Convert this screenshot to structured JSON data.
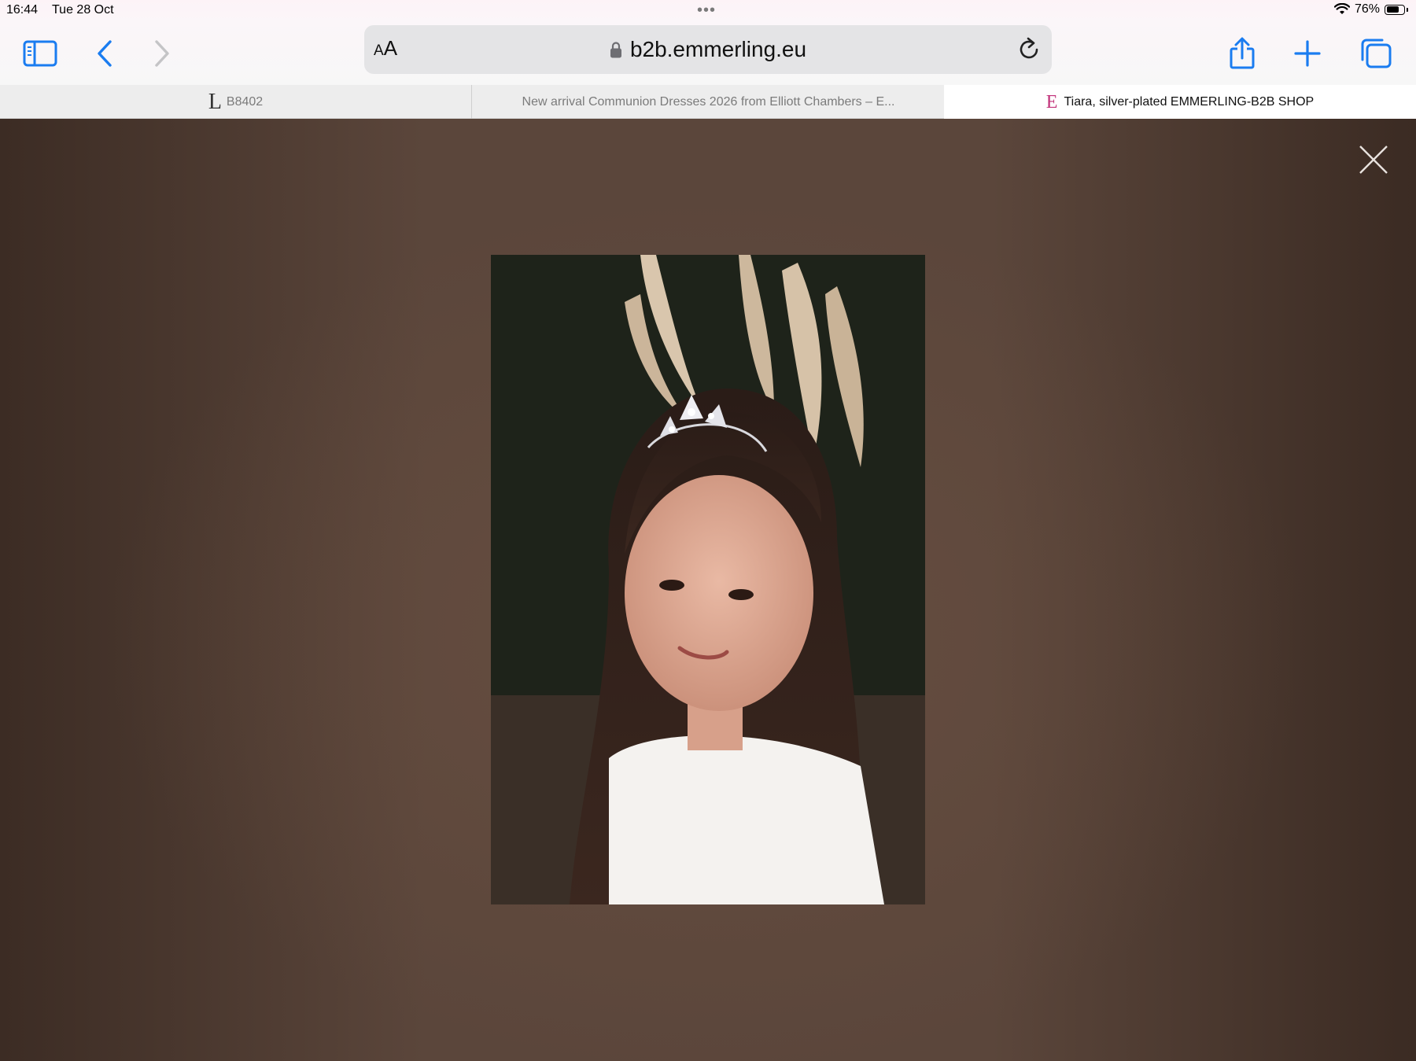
{
  "status_bar": {
    "time": "16:44",
    "date": "Tue 28 Oct",
    "battery": "76%",
    "battery_level": 0.76
  },
  "toolbar": {
    "text_size_label_small": "A",
    "text_size_label_large": "A",
    "url": "b2b.emmerling.eu"
  },
  "tabs": [
    {
      "favicon": "L",
      "title": "B8402"
    },
    {
      "title": "New arrival Communion Dresses 2026 from Elliott Chambers – E..."
    },
    {
      "favicon": "E",
      "title": "Tiara, silver-plated EMMERLING-B2B SHOP"
    }
  ],
  "icons": {
    "sidebar": "sidebar-icon",
    "back": "back-chevron-icon",
    "forward": "forward-chevron-icon",
    "lock": "lock-icon",
    "reload": "reload-icon",
    "share": "share-icon",
    "new_tab": "plus-icon",
    "tabs": "tab-overview-icon",
    "close": "close-icon",
    "wifi": "wifi-icon",
    "battery": "battery-icon"
  },
  "colors": {
    "accent": "#1a7cf0",
    "lightbox_bg": "#5b463b",
    "favicon_e": "#c2327a"
  }
}
